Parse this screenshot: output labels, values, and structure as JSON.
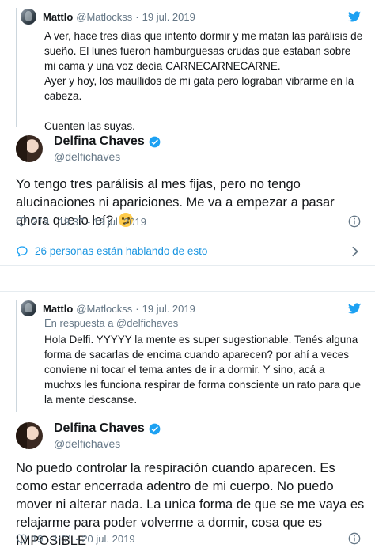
{
  "thread1": {
    "quote": {
      "name": "Mattlo",
      "handle": "@Matlockss",
      "separator": "·",
      "date": "19 jul. 2019",
      "text": "A ver, hace tres días que intento dormir y me matan las parálisis de sueño. El lunes fueron hamburguesas crudas que estaban sobre mi cama y una voz decía CARNECARNECARNE.\nAyer y hoy, los maullidos de mi gata pero lograban vibrarme en la cabeza.\n\nCuenten las suyas."
    },
    "author": {
      "name": "Delfina Chaves",
      "handle": "@delfichaves"
    },
    "text": "Yo tengo tres parálisis al mes fijas, pero no tengo alucinaciones ni apariciones. Me va a empezar a pasar ahora que lo leí?",
    "emoji": "slightly-frowning-face",
    "likes": "219",
    "timestamp": "19:37 - 19 jul. 2019",
    "conversation": "26 personas están hablando de esto"
  },
  "thread2": {
    "quote": {
      "name": "Mattlo",
      "handle": "@Matlockss",
      "separator": "·",
      "date": "19 jul. 2019",
      "reply_to": "En respuesta a @delfichaves",
      "text": "Hola Delfi. YYYYY la mente es super sugestionable. Tenés alguna forma de sacarlas de encima cuando aparecen? por ahí a veces conviene ni tocar el tema antes de ir a dormir. Y sino, acá a muchxs les funciona respirar de forma consciente un rato para que la mente descanse."
    },
    "author": {
      "name": "Delfina Chaves",
      "handle": "@delfichaves"
    },
    "text": "No puedo controlar la respiración cuando aparecen. Es como estar encerrada adentro de mi cuerpo. No puedo mover ni alterar nada. La unica forma de que se me vaya es relajarme para poder volverme a dormir, cosa que es IMPOSIBLE",
    "likes": "19",
    "timestamp": "1:01 - 20 jul. 2019"
  },
  "icons": {
    "bird": "twitter-bird-icon",
    "verified": "verified-badge-icon",
    "like": "heart-icon",
    "info": "info-icon",
    "conversation": "chat-bubble-icon",
    "chevron": "chevron-right-icon"
  },
  "colors": {
    "twitter_blue": "#1da1f2",
    "link_blue": "#1b95e0",
    "secondary_text": "#657786",
    "divider": "#e6ecf0"
  }
}
